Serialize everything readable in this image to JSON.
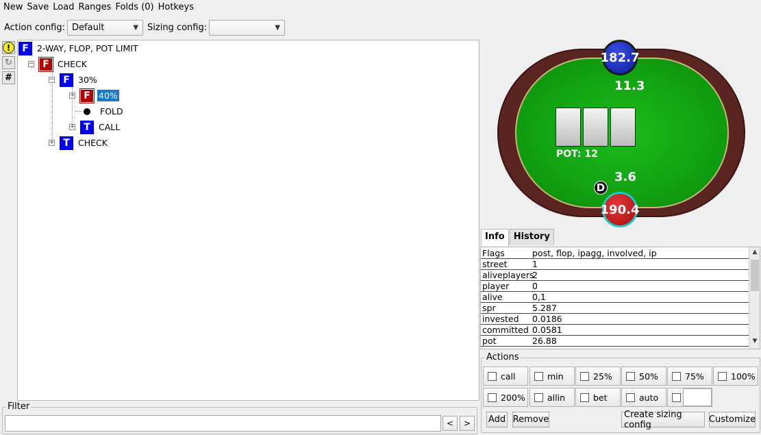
{
  "menu": [
    "New",
    "Save",
    "Load",
    "Ranges",
    "Folds (0)",
    "Hotkeys"
  ],
  "config": {
    "action_label": "Action config:",
    "action_value": "Default",
    "sizing_label": "Sizing config:",
    "sizing_value": ""
  },
  "toolbar": {
    "warn_glyph": "!",
    "refresh_glyph": "↻",
    "hash_glyph": "#"
  },
  "tree": {
    "root": {
      "badge": "F",
      "label": "2-WAY, FLOP, POT LIMIT"
    },
    "check1": {
      "badge": "F",
      "label": "CHECK"
    },
    "bet30": {
      "badge": "F",
      "label": "30%"
    },
    "raise40": {
      "badge": "F",
      "label": "40%"
    },
    "fold": {
      "label": "FOLD"
    },
    "call": {
      "badge": "T",
      "label": "CALL"
    },
    "check2": {
      "badge": "T",
      "label": "CHECK"
    }
  },
  "filter": {
    "title": "Filter",
    "value": "",
    "prev": "<",
    "next": ">"
  },
  "table": {
    "top_stack": "182.7",
    "top_bet": "11.3",
    "pot": "POT: 12",
    "bottom_bet": "3.6",
    "dealer": "D",
    "bottom_stack": "190.4"
  },
  "tabs": [
    "Info",
    "History"
  ],
  "info_rows": [
    {
      "key": "Flags",
      "value": "post, flop, ipagg, involved, ip"
    },
    {
      "key": "street",
      "value": "1"
    },
    {
      "key": "aliveplayers",
      "value": "2"
    },
    {
      "key": "player",
      "value": "0"
    },
    {
      "key": "alive",
      "value": "0,1"
    },
    {
      "key": "spr",
      "value": "5.287"
    },
    {
      "key": "invested",
      "value": "0.0186"
    },
    {
      "key": "committed",
      "value": "0.0581"
    },
    {
      "key": "pot",
      "value": "26.88"
    }
  ],
  "actions": {
    "title": "Actions",
    "row1": [
      "call",
      "min",
      "25%",
      "50%",
      "75%",
      "100%"
    ],
    "row2": [
      "200%",
      "allin",
      "bet",
      "auto"
    ],
    "custom_value": "",
    "add": "Add",
    "remove": "Remove",
    "create_sizing": "Create sizing config",
    "customize": "Customize"
  },
  "colors": {
    "badge_blue": "#0000ee",
    "badge_red": "#b00000",
    "selection": "#1b78d0",
    "felt": "#12a312",
    "rail": "#5a2420"
  }
}
